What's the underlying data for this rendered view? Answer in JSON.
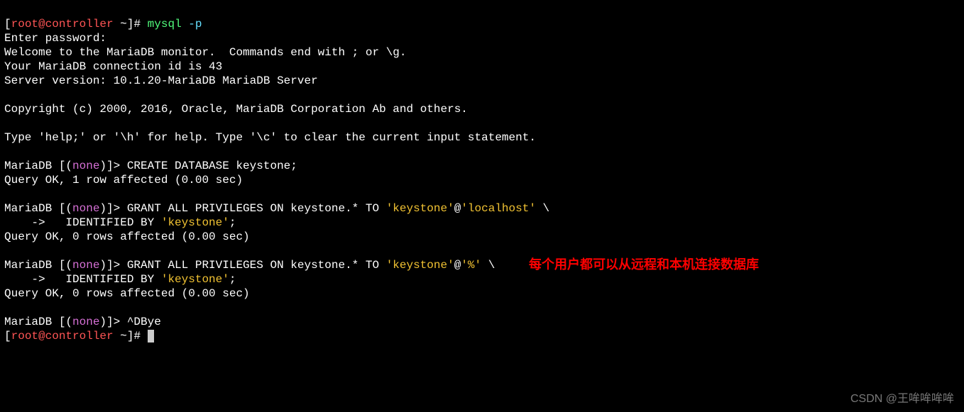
{
  "prompt1_open": "[",
  "prompt1_user": "root@controller",
  "prompt1_tilde": " ~",
  "prompt1_close": "]# ",
  "cmd1_bin": "mysql",
  "cmd1_arg": " -p",
  "line_enter_pw": "Enter password:",
  "line_welcome": "Welcome to the MariaDB monitor.  Commands end with ; or \\g.",
  "line_connid": "Your MariaDB connection id is 43",
  "line_server": "Server version: 10.1.20-MariaDB MariaDB Server",
  "line_copyright": "Copyright (c) 2000, 2016, Oracle, MariaDB Corporation Ab and others.",
  "line_help": "Type 'help;' or '\\h' for help. Type '\\c' to clear the current input statement.",
  "maria_pre": "MariaDB [(",
  "maria_none": "none",
  "maria_post": ")]> ",
  "stmt_create_db": "CREATE DATABASE keystone;",
  "result_create": "Query OK, 1 row affected (0.00 sec)",
  "stmt_grant1_a": "GRANT ALL PRIVILEGES ON keystone.* TO ",
  "q_keystone": "'keystone'",
  "at": "@",
  "q_localhost": "'localhost'",
  "backslash": " \\",
  "cont_prompt": "    ->   ",
  "stmt_identified": "IDENTIFIED BY ",
  "semi": ";",
  "result_grant": "Query OK, 0 rows affected (0.00 sec)",
  "q_percent": "'%'",
  "stmt_bye": "^DBye",
  "prompt2_open": "[",
  "prompt2_user": "root@controller",
  "prompt2_tilde": " ~",
  "prompt2_close": "]# ",
  "annotation_text": "每个用户都可以从远程和本机连接数据库",
  "watermark_text": "CSDN @王哞哞哞哞"
}
